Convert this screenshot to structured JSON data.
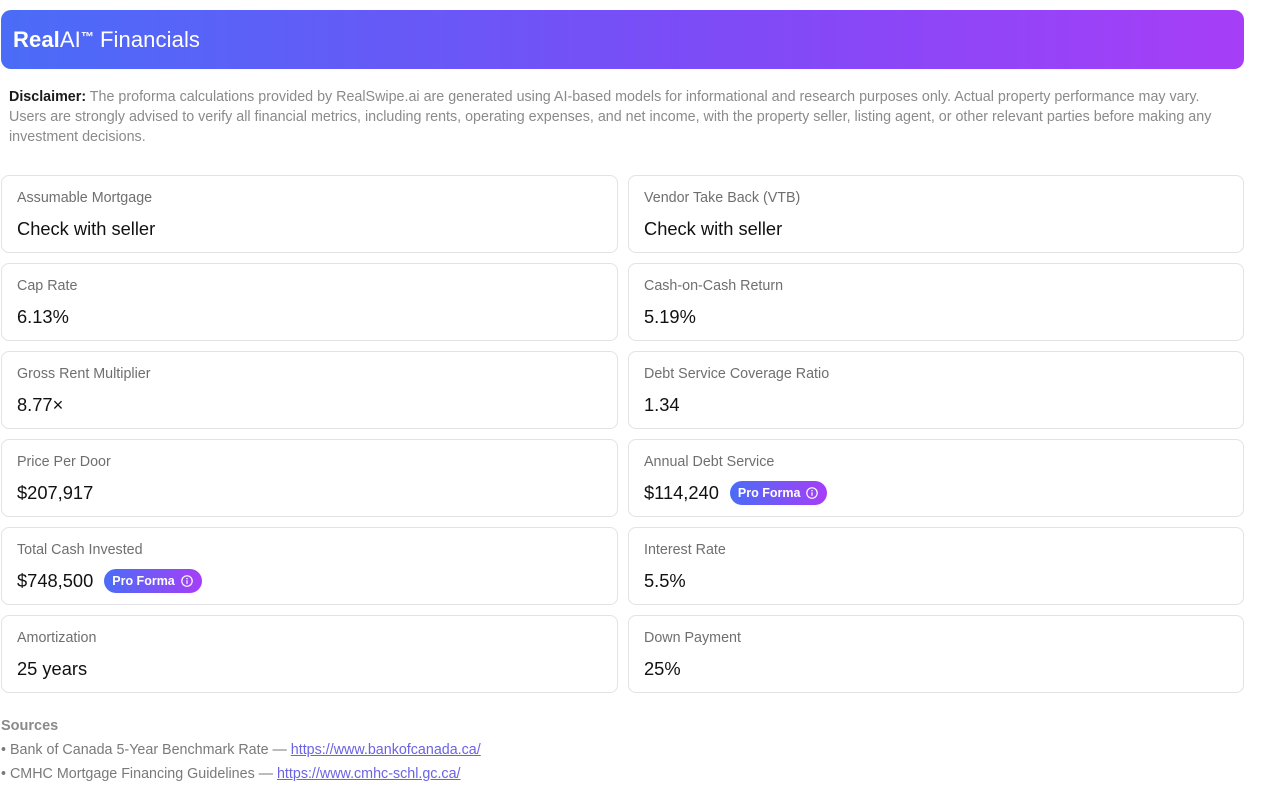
{
  "header": {
    "brand_bold": "Real",
    "brand_regular": "AI",
    "brand_tm": "™",
    "brand_suffix": "Financials"
  },
  "disclaimer": {
    "lead": "Disclaimer:",
    "text": " The proforma calculations provided by RealSwipe.ai are generated using AI-based models for informational and research purposes only. Actual property performance may vary. Users are strongly advised to verify all financial metrics, including rents, operating expenses, and net income, with the property seller, listing agent, or other relevant parties before making any investment decisions."
  },
  "badge_label": "Pro Forma",
  "cards": [
    {
      "label": "Assumable Mortgage",
      "value": "Check with seller"
    },
    {
      "label": "Vendor Take Back (VTB)",
      "value": "Check with seller"
    },
    {
      "label": "Cap Rate",
      "value": "6.13%"
    },
    {
      "label": "Cash-on-Cash Return",
      "value": "5.19%"
    },
    {
      "label": "Gross Rent Multiplier",
      "value": "8.77×"
    },
    {
      "label": "Debt Service Coverage Ratio",
      "value": "1.34"
    },
    {
      "label": "Price Per Door",
      "value": "$207,917"
    },
    {
      "label": "Annual Debt Service",
      "value": "$114,240"
    },
    {
      "label": "Total Cash Invested",
      "value": "$748,500"
    },
    {
      "label": "Interest Rate",
      "value": "5.5%"
    },
    {
      "label": "Amortization",
      "value": "25 years"
    },
    {
      "label": "Down Payment",
      "value": "25%"
    }
  ],
  "sources": {
    "title": "Sources",
    "items": [
      {
        "prefix": "• Bank of Canada 5-Year Benchmark Rate — ",
        "link": "https://www.bankofcanada.ca/"
      },
      {
        "prefix": "• CMHC Mortgage Financing Guidelines — ",
        "link": "https://www.cmhc-schl.gc.ca/"
      }
    ]
  },
  "colors": {
    "gradient_start": "#4a6cf7",
    "gradient_end": "#a63ef7",
    "link": "#6b63e6"
  }
}
